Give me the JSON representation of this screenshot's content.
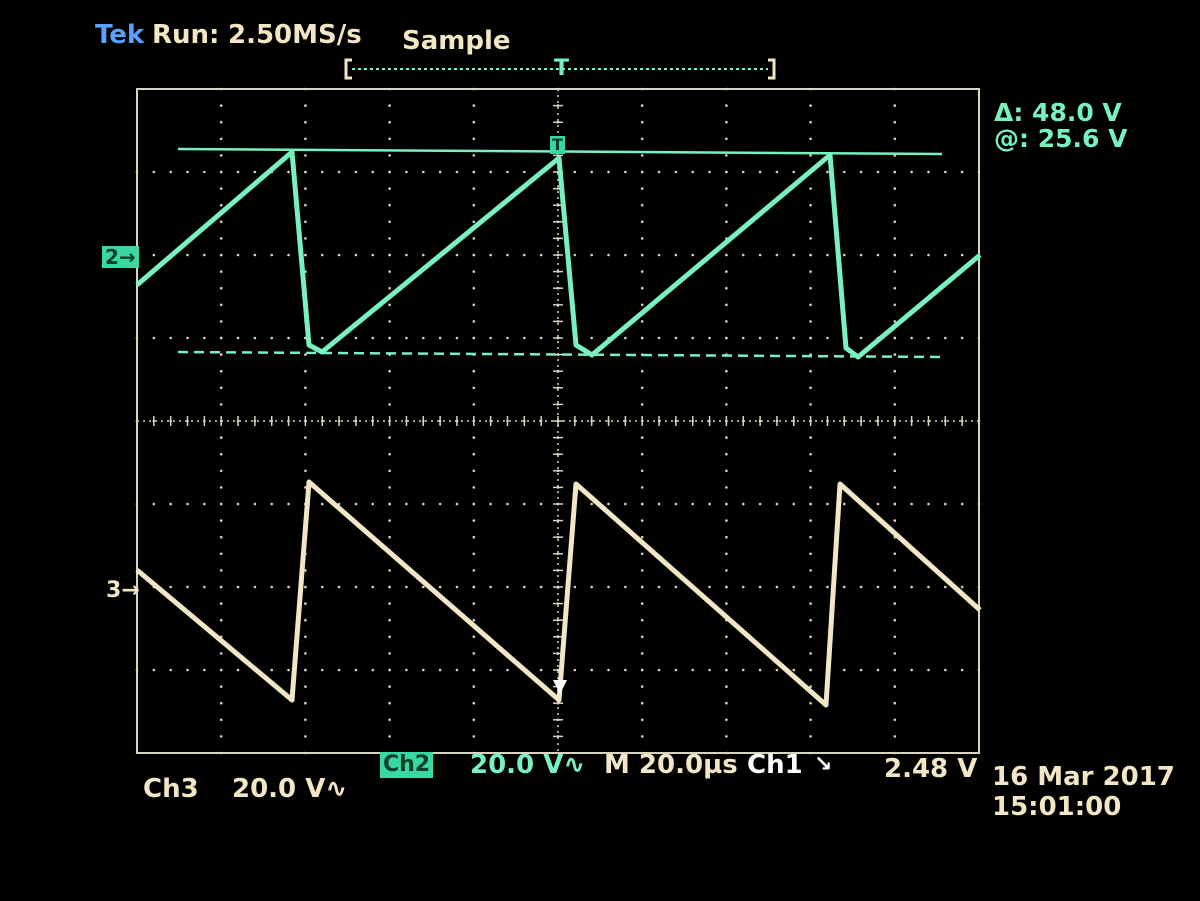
{
  "header": {
    "brand": "Tek",
    "run_state": "Run:",
    "sample_rate": "2.50MS/s",
    "acq_mode": "Sample",
    "trigger_marker": "T"
  },
  "cursor_readout": {
    "delta": "Δ: 48.0 V",
    "at": "@: 25.6 V"
  },
  "markers": {
    "ch2": "2→",
    "ch3": "3→",
    "cursor_box": "T"
  },
  "footer": {
    "ch3_label": "Ch3",
    "ch3_scale": "20.0 V∿",
    "ch2_label": "Ch2",
    "ch2_scale": "20.0 V∿",
    "timebase": "M 20.0µs",
    "trig_source": "Ch1",
    "trig_slope": "↘",
    "trig_level": "2.48 V",
    "date": "16 Mar 2017",
    "time": "15:01:00"
  },
  "colors": {
    "ch2": "#78f0c0",
    "ch3": "#f2e6c4",
    "graticule": "#d8d4c0",
    "background": "#000000"
  }
}
